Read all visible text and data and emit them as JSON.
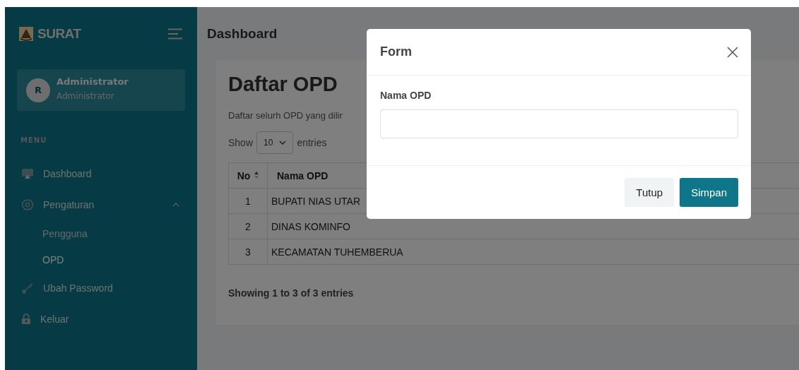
{
  "sidebar": {
    "brand": "SURAT",
    "user": {
      "initial": "R",
      "name": "Administrator",
      "role": "Administrator"
    },
    "menu_heading": "MENU",
    "items": [
      {
        "label": "Dashboard",
        "selected": false
      },
      {
        "label": "Pengaturan",
        "selected": false,
        "expanded": true,
        "children": [
          {
            "label": "Pengguna",
            "selected": false
          },
          {
            "label": "OPD",
            "selected": true
          }
        ]
      },
      {
        "label": "Ubah Password",
        "selected": false
      },
      {
        "label": "Keluar",
        "selected": false
      }
    ]
  },
  "header": {
    "title": "Dashboard"
  },
  "card": {
    "title": "Daftar OPD",
    "description": "Daftar selurh OPD yang dilir",
    "length": {
      "before": "Show",
      "value": "10",
      "after": "entries"
    },
    "table": {
      "columns": [
        {
          "label": "No",
          "sorted": true
        },
        {
          "label": "Nama OPD",
          "sorted": false
        }
      ],
      "rows": [
        [
          "1",
          "BUPATI NIAS UTAR"
        ],
        [
          "2",
          "DINAS KOMINFO"
        ],
        [
          "3",
          "KECAMATAN TUHEMBERUA"
        ]
      ]
    },
    "info": "Showing 1 to 3 of 3 entries"
  },
  "modal": {
    "title": "Form",
    "field_label": "Nama OPD",
    "buttons": [
      {
        "label": "Tutup",
        "kind": "secondary"
      },
      {
        "label": "Simpan",
        "kind": "primary"
      }
    ]
  }
}
